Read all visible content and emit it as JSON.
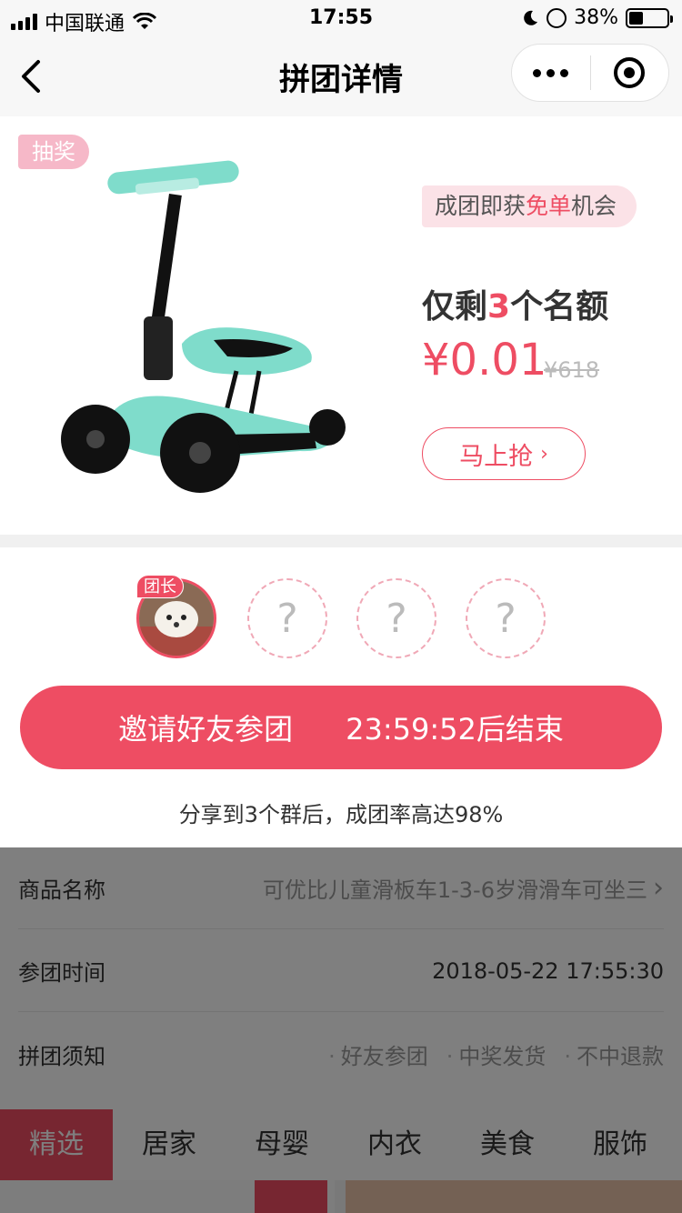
{
  "status_bar": {
    "carrier": "中国联通",
    "time": "17:55",
    "battery": "38%"
  },
  "nav": {
    "title": "拼团详情"
  },
  "product": {
    "tag": "抽奖",
    "promo_pre": "成团即获",
    "promo_hl": "免单",
    "promo_post": "机会",
    "remain_pre": "仅剩",
    "remain_num": "3",
    "remain_post": "个名额",
    "price": "¥0.01",
    "original_price": "¥618",
    "grab_label": "马上抢"
  },
  "members": {
    "leader_tag": "团长",
    "empty_slots": [
      "?",
      "?",
      "?"
    ],
    "invite_label": "邀请好友参团",
    "countdown": "23:59:52后结束",
    "share_tip": "分享到3个群后，成团率高达98%"
  },
  "info": {
    "product_name_label": "商品名称",
    "product_name_value": "可优比儿童滑板车1-3-6岁滑滑车可坐三",
    "join_time_label": "参团时间",
    "join_time_value": "2018-05-22 17:55:30",
    "notice_label": "拼团须知",
    "notice_items": [
      "好友参团",
      "中奖发货",
      "不中退款"
    ]
  },
  "tabs": [
    "精选",
    "居家",
    "母婴",
    "内衣",
    "美食",
    "服饰"
  ],
  "colors": {
    "accent": "#ee4d63",
    "accent_light": "#fbe2e7"
  }
}
